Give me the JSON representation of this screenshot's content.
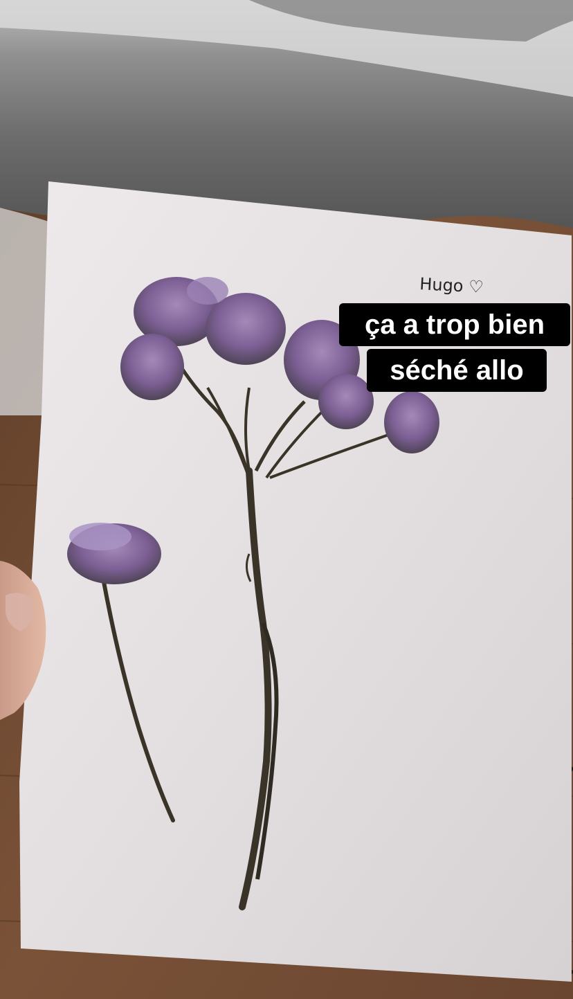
{
  "story": {
    "caption_lines": [
      "ça a trop bien",
      "séché allo"
    ],
    "handwritten_note": "Hugo ♡"
  },
  "colors": {
    "caption_background": "#000000",
    "caption_text": "#ffffff",
    "paper": "#e6e2e4",
    "floor_wood": "#7a5238",
    "bedding": "#8f8f8f",
    "flower_purple": "#8a6aa8",
    "stem": "#3a3327"
  },
  "objects": [
    "hand-holding-card",
    "white-card",
    "pressed-sea-lavender-flower",
    "small-pressed-flower",
    "gray-bedding",
    "wooden-floor"
  ]
}
